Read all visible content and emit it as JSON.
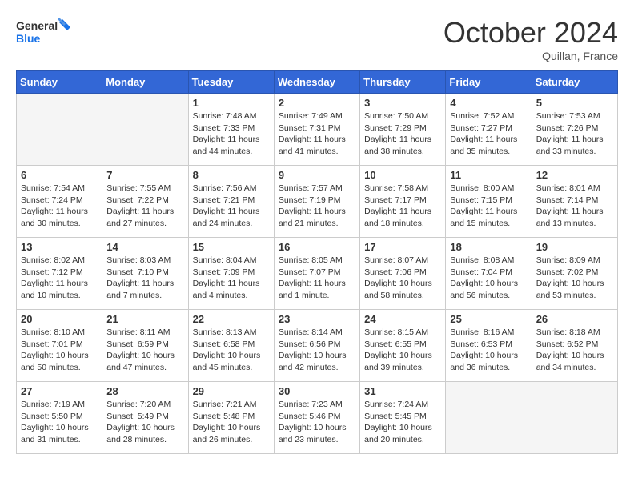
{
  "header": {
    "logo_text_general": "General",
    "logo_text_blue": "Blue",
    "month_title": "October 2024",
    "location": "Quillan, France"
  },
  "days_of_week": [
    "Sunday",
    "Monday",
    "Tuesday",
    "Wednesday",
    "Thursday",
    "Friday",
    "Saturday"
  ],
  "weeks": [
    [
      {
        "day": "",
        "sunrise": "",
        "sunset": "",
        "daylight": ""
      },
      {
        "day": "",
        "sunrise": "",
        "sunset": "",
        "daylight": ""
      },
      {
        "day": "1",
        "sunrise": "Sunrise: 7:48 AM",
        "sunset": "Sunset: 7:33 PM",
        "daylight": "Daylight: 11 hours and 44 minutes."
      },
      {
        "day": "2",
        "sunrise": "Sunrise: 7:49 AM",
        "sunset": "Sunset: 7:31 PM",
        "daylight": "Daylight: 11 hours and 41 minutes."
      },
      {
        "day": "3",
        "sunrise": "Sunrise: 7:50 AM",
        "sunset": "Sunset: 7:29 PM",
        "daylight": "Daylight: 11 hours and 38 minutes."
      },
      {
        "day": "4",
        "sunrise": "Sunrise: 7:52 AM",
        "sunset": "Sunset: 7:27 PM",
        "daylight": "Daylight: 11 hours and 35 minutes."
      },
      {
        "day": "5",
        "sunrise": "Sunrise: 7:53 AM",
        "sunset": "Sunset: 7:26 PM",
        "daylight": "Daylight: 11 hours and 33 minutes."
      }
    ],
    [
      {
        "day": "6",
        "sunrise": "Sunrise: 7:54 AM",
        "sunset": "Sunset: 7:24 PM",
        "daylight": "Daylight: 11 hours and 30 minutes."
      },
      {
        "day": "7",
        "sunrise": "Sunrise: 7:55 AM",
        "sunset": "Sunset: 7:22 PM",
        "daylight": "Daylight: 11 hours and 27 minutes."
      },
      {
        "day": "8",
        "sunrise": "Sunrise: 7:56 AM",
        "sunset": "Sunset: 7:21 PM",
        "daylight": "Daylight: 11 hours and 24 minutes."
      },
      {
        "day": "9",
        "sunrise": "Sunrise: 7:57 AM",
        "sunset": "Sunset: 7:19 PM",
        "daylight": "Daylight: 11 hours and 21 minutes."
      },
      {
        "day": "10",
        "sunrise": "Sunrise: 7:58 AM",
        "sunset": "Sunset: 7:17 PM",
        "daylight": "Daylight: 11 hours and 18 minutes."
      },
      {
        "day": "11",
        "sunrise": "Sunrise: 8:00 AM",
        "sunset": "Sunset: 7:15 PM",
        "daylight": "Daylight: 11 hours and 15 minutes."
      },
      {
        "day": "12",
        "sunrise": "Sunrise: 8:01 AM",
        "sunset": "Sunset: 7:14 PM",
        "daylight": "Daylight: 11 hours and 13 minutes."
      }
    ],
    [
      {
        "day": "13",
        "sunrise": "Sunrise: 8:02 AM",
        "sunset": "Sunset: 7:12 PM",
        "daylight": "Daylight: 11 hours and 10 minutes."
      },
      {
        "day": "14",
        "sunrise": "Sunrise: 8:03 AM",
        "sunset": "Sunset: 7:10 PM",
        "daylight": "Daylight: 11 hours and 7 minutes."
      },
      {
        "day": "15",
        "sunrise": "Sunrise: 8:04 AM",
        "sunset": "Sunset: 7:09 PM",
        "daylight": "Daylight: 11 hours and 4 minutes."
      },
      {
        "day": "16",
        "sunrise": "Sunrise: 8:05 AM",
        "sunset": "Sunset: 7:07 PM",
        "daylight": "Daylight: 11 hours and 1 minute."
      },
      {
        "day": "17",
        "sunrise": "Sunrise: 8:07 AM",
        "sunset": "Sunset: 7:06 PM",
        "daylight": "Daylight: 10 hours and 58 minutes."
      },
      {
        "day": "18",
        "sunrise": "Sunrise: 8:08 AM",
        "sunset": "Sunset: 7:04 PM",
        "daylight": "Daylight: 10 hours and 56 minutes."
      },
      {
        "day": "19",
        "sunrise": "Sunrise: 8:09 AM",
        "sunset": "Sunset: 7:02 PM",
        "daylight": "Daylight: 10 hours and 53 minutes."
      }
    ],
    [
      {
        "day": "20",
        "sunrise": "Sunrise: 8:10 AM",
        "sunset": "Sunset: 7:01 PM",
        "daylight": "Daylight: 10 hours and 50 minutes."
      },
      {
        "day": "21",
        "sunrise": "Sunrise: 8:11 AM",
        "sunset": "Sunset: 6:59 PM",
        "daylight": "Daylight: 10 hours and 47 minutes."
      },
      {
        "day": "22",
        "sunrise": "Sunrise: 8:13 AM",
        "sunset": "Sunset: 6:58 PM",
        "daylight": "Daylight: 10 hours and 45 minutes."
      },
      {
        "day": "23",
        "sunrise": "Sunrise: 8:14 AM",
        "sunset": "Sunset: 6:56 PM",
        "daylight": "Daylight: 10 hours and 42 minutes."
      },
      {
        "day": "24",
        "sunrise": "Sunrise: 8:15 AM",
        "sunset": "Sunset: 6:55 PM",
        "daylight": "Daylight: 10 hours and 39 minutes."
      },
      {
        "day": "25",
        "sunrise": "Sunrise: 8:16 AM",
        "sunset": "Sunset: 6:53 PM",
        "daylight": "Daylight: 10 hours and 36 minutes."
      },
      {
        "day": "26",
        "sunrise": "Sunrise: 8:18 AM",
        "sunset": "Sunset: 6:52 PM",
        "daylight": "Daylight: 10 hours and 34 minutes."
      }
    ],
    [
      {
        "day": "27",
        "sunrise": "Sunrise: 7:19 AM",
        "sunset": "Sunset: 5:50 PM",
        "daylight": "Daylight: 10 hours and 31 minutes."
      },
      {
        "day": "28",
        "sunrise": "Sunrise: 7:20 AM",
        "sunset": "Sunset: 5:49 PM",
        "daylight": "Daylight: 10 hours and 28 minutes."
      },
      {
        "day": "29",
        "sunrise": "Sunrise: 7:21 AM",
        "sunset": "Sunset: 5:48 PM",
        "daylight": "Daylight: 10 hours and 26 minutes."
      },
      {
        "day": "30",
        "sunrise": "Sunrise: 7:23 AM",
        "sunset": "Sunset: 5:46 PM",
        "daylight": "Daylight: 10 hours and 23 minutes."
      },
      {
        "day": "31",
        "sunrise": "Sunrise: 7:24 AM",
        "sunset": "Sunset: 5:45 PM",
        "daylight": "Daylight: 10 hours and 20 minutes."
      },
      {
        "day": "",
        "sunrise": "",
        "sunset": "",
        "daylight": ""
      },
      {
        "day": "",
        "sunrise": "",
        "sunset": "",
        "daylight": ""
      }
    ]
  ]
}
